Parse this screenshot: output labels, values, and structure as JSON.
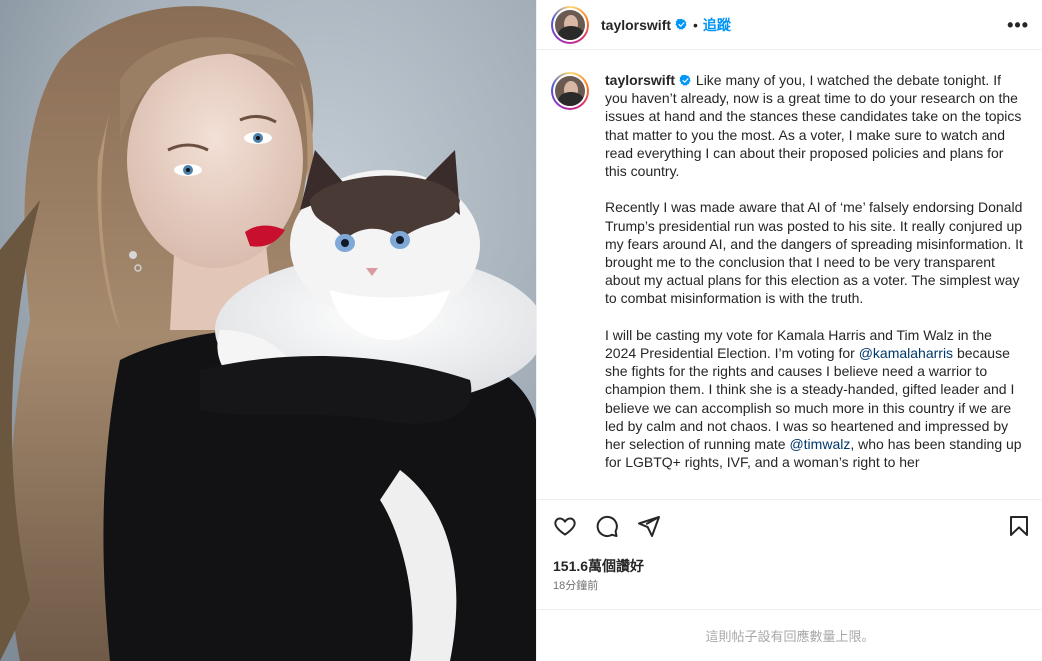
{
  "post": {
    "username": "taylorswift",
    "separator": "•",
    "follow_label": "追蹤",
    "more_icon": "more-horizontal-icon",
    "photo_description_icon": "post-photo"
  },
  "caption": {
    "username": "taylorswift",
    "p1": " Like many of you, I watched the debate tonight. If you haven’t already, now is a great time to do your research on the issues at hand and the stances these candidates take on the topics that matter to you the most. As a voter, I make sure to watch and read everything I can about their proposed policies and plans for this country.",
    "p2": "Recently I was made aware that AI of ‘me’ falsely endorsing Donald Trump’s presidential run was posted to his site. It really conjured up my fears around AI, and the dangers of spreading misinformation. It brought me to the conclusion that I need to be very transparent about my actual plans for this election as a voter. The simplest way to combat misinformation is with the truth.",
    "p3a": "I will be casting my vote for Kamala Harris and Tim Walz in the 2024 Presidential Election. I’m voting for ",
    "mention1": "@kamalaharris",
    "p3b": " because she fights for the rights and causes I believe need a warrior to champion them. I think she is a steady-handed, gifted leader and I believe we can accomplish so much more in this country if we are led by calm and not chaos. I was so heartened and impressed by her selection of running mate ",
    "mention2": "@timwalz",
    "p3c": ", who has been standing up for LGBTQ+ rights, IVF, and a woman’s right to her"
  },
  "actions": {
    "like_icon": "heart-icon",
    "comment_icon": "comment-icon",
    "share_icon": "share-icon",
    "save_icon": "bookmark-icon"
  },
  "stats": {
    "likes": "151.6萬個讚好",
    "time": "18分鐘前"
  },
  "footer": {
    "comments_limited": "這則帖子設有回應數量上限。"
  },
  "colors": {
    "accent": "#0095f6",
    "mention": "#00376b",
    "text": "#262626",
    "muted": "#737373"
  }
}
